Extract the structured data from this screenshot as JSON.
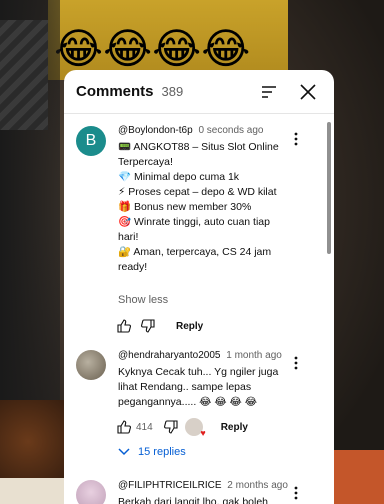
{
  "video": {
    "emojis": "😂😂😂😂"
  },
  "panel": {
    "title": "Comments",
    "count": "389"
  },
  "comments": [
    {
      "avatar_letter": "B",
      "author": "@Boylondon-t6p",
      "time": "0 seconds ago",
      "lines": [
        "📟 ANGKOT88 – Situs Slot Online Terpercaya!",
        "💎 Minimal depo cuma 1k",
        "⚡ Proses cepat – depo & WD kilat",
        "🎁 Bonus new member 30%",
        "🎯 Winrate tinggi, auto cuan tiap hari!",
        "🔐 Aman, terpercaya, CS 24 jam ready!"
      ],
      "show_less": "Show less",
      "reply": "Reply"
    },
    {
      "author": "@hendraharyanto2005",
      "time": "1 month ago",
      "text": "Kyknya Cecak tuh... Yg ngiler juga lihat Rendang.. sampe lepas pegangannya..... 😂 😂 😂 😂",
      "likes": "414",
      "reply": "Reply",
      "replies": "15 replies"
    },
    {
      "author": "@FILIPHTRICEILRICE",
      "time": "2 months ago",
      "text": "Berkah dari langit lho, gak boleh"
    }
  ]
}
